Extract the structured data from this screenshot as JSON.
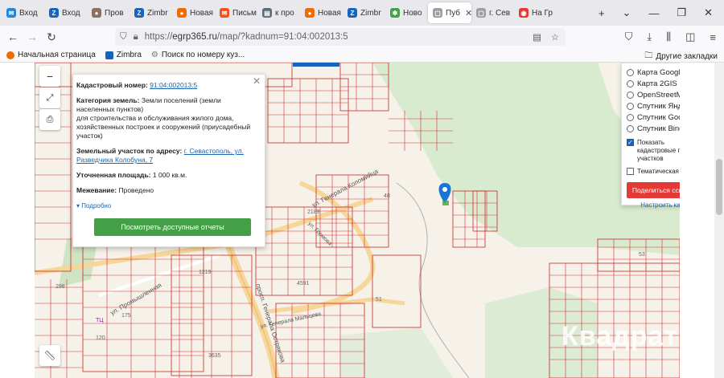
{
  "tabs": [
    {
      "label": "Вход",
      "icon": "mail-icon",
      "color": "#1e88e5",
      "glyph": "✉"
    },
    {
      "label": "Вход",
      "icon": "zimbra-icon",
      "color": "#1565c0",
      "glyph": "Z"
    },
    {
      "label": "Пров",
      "icon": "owl-icon",
      "color": "#8d6e63",
      "glyph": "●"
    },
    {
      "label": "Zimbr",
      "icon": "zimbra-icon",
      "color": "#1565c0",
      "glyph": "Z"
    },
    {
      "label": "Новая",
      "icon": "firefox-icon",
      "color": "#ef6c00",
      "glyph": "●"
    },
    {
      "label": "Письм",
      "icon": "mail-icon",
      "color": "#f4511e",
      "glyph": "✉"
    },
    {
      "label": "к про",
      "icon": "doc-icon",
      "color": "#546e7a",
      "glyph": "▤"
    },
    {
      "label": "Новая",
      "icon": "firefox-icon",
      "color": "#ef6c00",
      "glyph": "●"
    },
    {
      "label": "Zimbr",
      "icon": "zimbra-icon",
      "color": "#1565c0",
      "glyph": "Z"
    },
    {
      "label": "Ново",
      "icon": "slack-icon",
      "color": "#43a047",
      "glyph": "✱"
    },
    {
      "label": "Пуб",
      "icon": "page-icon",
      "color": "#9e9e9e",
      "glyph": "▢",
      "active": true
    },
    {
      "label": "г. Сев",
      "icon": "page-icon",
      "color": "#9e9e9e",
      "glyph": "▢"
    },
    {
      "label": "На Гр",
      "icon": "record-icon",
      "color": "#e53935",
      "glyph": "◉"
    }
  ],
  "url": {
    "prefix": "https://",
    "domain": "egrp365.ru",
    "rest": "/map/?kadnum=91:04:002013:5"
  },
  "bookmarks": [
    {
      "label": "Начальная страница",
      "icon": "firefox-icon",
      "color": "#ef6c00"
    },
    {
      "label": "Zimbra",
      "icon": "zimbra-icon",
      "color": "#1565c0"
    },
    {
      "label": "Поиск по номеру куз...",
      "icon": "gear-icon",
      "color": "#777777"
    }
  ],
  "other_bookmarks": "Другие закладки",
  "popup": {
    "cadastral_label": "Кадастровый номер:",
    "cadastral_value": "91:04:002013:5",
    "category_label": "Категория земель:",
    "category_value": "Земли поселений (земли населенных пунктов)",
    "purpose": "для строительства и обслуживания жилого дома, хозяйственных построек и сооружений (приусадебный участок)",
    "address_label": "Земельный участок по адресу:",
    "address_value": "г. Севастополь, ул. Разведчика Колобуна, 7",
    "area_label": "Уточненная площадь:",
    "area_value": "1 000 кв.м.",
    "survey_label": "Межевание:",
    "survey_value": "Проведено",
    "more": "Подробно",
    "button": "Посмотреть доступные отчеты"
  },
  "layers": {
    "options": [
      "Карта Google",
      "Карта 2GIS",
      "OpenStreetMap",
      "Спутник Яндекс",
      "Спутник Google",
      "Спутник Bing"
    ],
    "show_boundaries": "Показать кадастровые границы участков",
    "thematic": "Тематическая карта",
    "share_button": "Поделиться ссылкой",
    "setup_link": "Настроить карту"
  },
  "map_labels": {
    "street1": "ул. Генерала Коломийца",
    "street2": "просп. Генерала Острякова",
    "street3": "ул. Промышленная",
    "street4": "ул. Генерала Мальцева",
    "street5": "ул. Громова",
    "n1": "48",
    "n2": "2189",
    "n3": "4591",
    "n4": "51",
    "n5": "3635",
    "n6": "298",
    "n7": "175",
    "n8": "1219",
    "n9": "53",
    "n10": "120",
    "n11": "ТЦ"
  },
  "watermark": "Квадрат"
}
